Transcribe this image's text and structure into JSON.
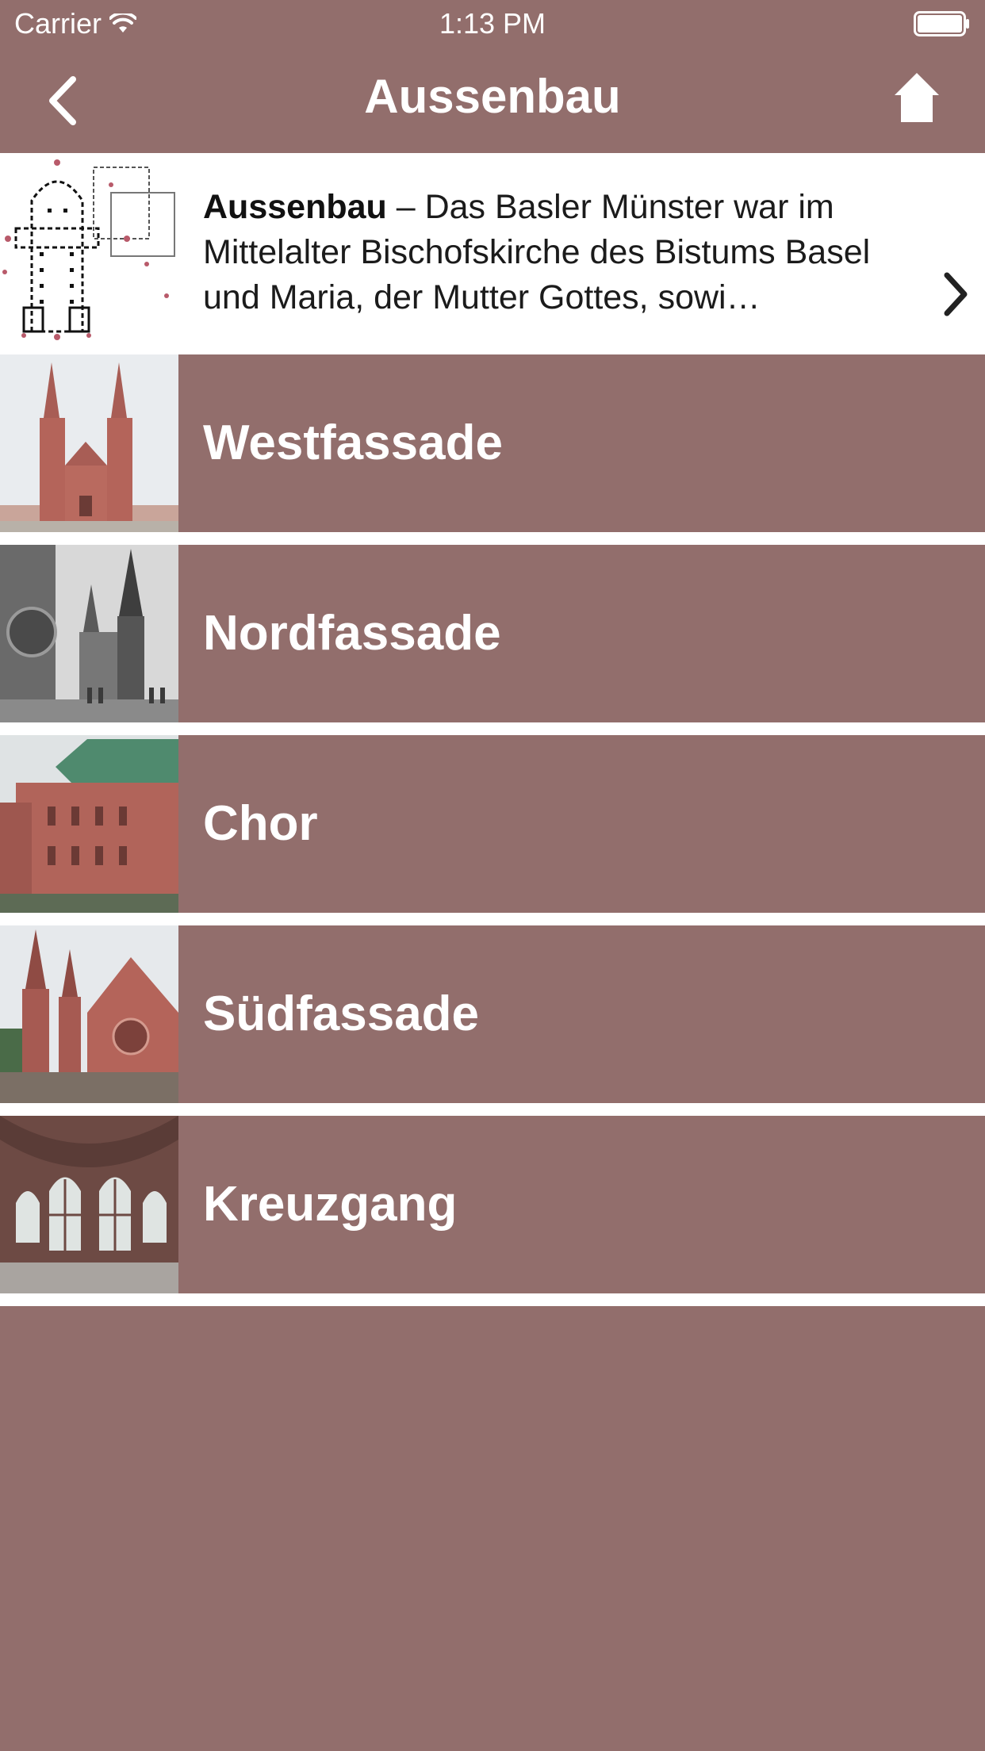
{
  "status_bar": {
    "carrier": "Carrier",
    "time": "1:13 PM"
  },
  "nav": {
    "title": "Aussenbau",
    "back_icon": "chevron-left-icon",
    "home_icon": "home-icon"
  },
  "intro": {
    "heading": "Aussenbau",
    "text": " – Das Basler Münster war im Mittelalter Bischofskirche des Bistums Basel und Maria, der Mutter Gottes, sowi…",
    "chevron_icon": "chevron-right-icon"
  },
  "items": [
    {
      "label": "Westfassade"
    },
    {
      "label": "Nordfassade"
    },
    {
      "label": "Chor"
    },
    {
      "label": "Südfassade"
    },
    {
      "label": "Kreuzgang"
    }
  ],
  "colors": {
    "background": "#926e6c",
    "separator": "#ffffff",
    "text_light": "#ffffff"
  }
}
